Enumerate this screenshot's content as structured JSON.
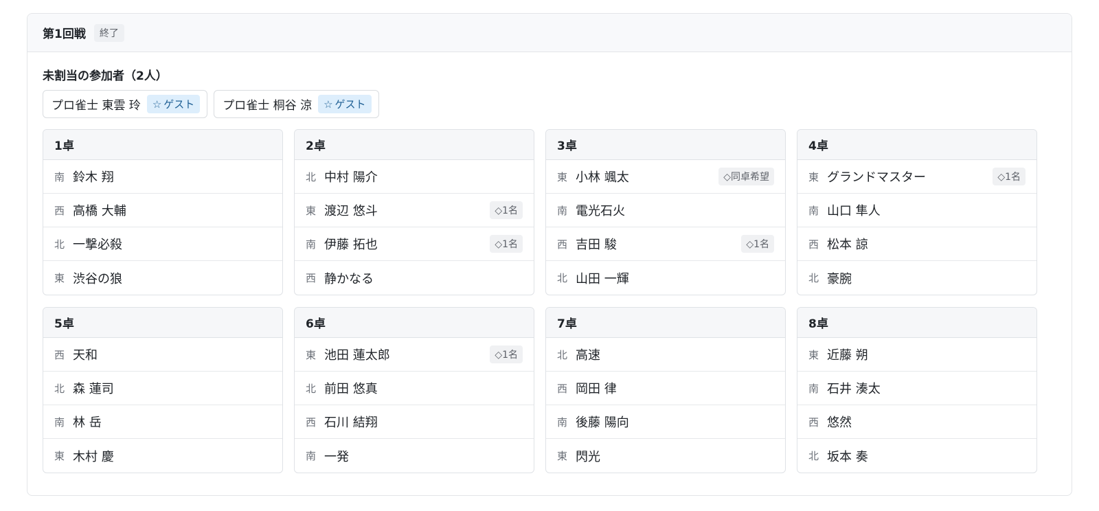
{
  "round": {
    "title": "第1回戦",
    "status": "終了"
  },
  "unassigned": {
    "title": "未割当の参加者（2人）",
    "participants": [
      {
        "name": "プロ雀士 東雲 玲",
        "badge_icon": "star-icon",
        "badge": "ゲスト"
      },
      {
        "name": "プロ雀士 桐谷 涼",
        "badge_icon": "star-icon",
        "badge": "ゲスト"
      }
    ]
  },
  "tables": [
    {
      "label": "1卓",
      "seats": [
        {
          "wind": "南",
          "name": "鈴木 翔",
          "tag": ""
        },
        {
          "wind": "西",
          "name": "高橋 大輔",
          "tag": ""
        },
        {
          "wind": "北",
          "name": "一撃必殺",
          "tag": ""
        },
        {
          "wind": "東",
          "name": "渋谷の狼",
          "tag": ""
        }
      ]
    },
    {
      "label": "2卓",
      "seats": [
        {
          "wind": "北",
          "name": "中村 陽介",
          "tag": ""
        },
        {
          "wind": "東",
          "name": "渡辺 悠斗",
          "tag": "◇1名"
        },
        {
          "wind": "南",
          "name": "伊藤 拓也",
          "tag": "◇1名"
        },
        {
          "wind": "西",
          "name": "静かなる",
          "tag": ""
        }
      ]
    },
    {
      "label": "3卓",
      "seats": [
        {
          "wind": "東",
          "name": "小林 颯太",
          "tag": "◇同卓希望"
        },
        {
          "wind": "南",
          "name": "電光石火",
          "tag": ""
        },
        {
          "wind": "西",
          "name": "吉田 駿",
          "tag": "◇1名"
        },
        {
          "wind": "北",
          "name": "山田 一輝",
          "tag": ""
        }
      ]
    },
    {
      "label": "4卓",
      "seats": [
        {
          "wind": "東",
          "name": "グランドマスター",
          "tag": "◇1名"
        },
        {
          "wind": "南",
          "name": "山口 隼人",
          "tag": ""
        },
        {
          "wind": "西",
          "name": "松本 諒",
          "tag": ""
        },
        {
          "wind": "北",
          "name": "豪腕",
          "tag": ""
        }
      ]
    },
    {
      "label": "5卓",
      "seats": [
        {
          "wind": "西",
          "name": "天和",
          "tag": ""
        },
        {
          "wind": "北",
          "name": "森 蓮司",
          "tag": ""
        },
        {
          "wind": "南",
          "name": "林 岳",
          "tag": ""
        },
        {
          "wind": "東",
          "name": "木村 慶",
          "tag": ""
        }
      ]
    },
    {
      "label": "6卓",
      "seats": [
        {
          "wind": "東",
          "name": "池田 蓮太郎",
          "tag": "◇1名"
        },
        {
          "wind": "北",
          "name": "前田 悠真",
          "tag": ""
        },
        {
          "wind": "西",
          "name": "石川 結翔",
          "tag": ""
        },
        {
          "wind": "南",
          "name": "一発",
          "tag": ""
        }
      ]
    },
    {
      "label": "7卓",
      "seats": [
        {
          "wind": "北",
          "name": "高速",
          "tag": ""
        },
        {
          "wind": "西",
          "name": "岡田 律",
          "tag": ""
        },
        {
          "wind": "南",
          "name": "後藤 陽向",
          "tag": ""
        },
        {
          "wind": "東",
          "name": "閃光",
          "tag": ""
        }
      ]
    },
    {
      "label": "8卓",
      "seats": [
        {
          "wind": "東",
          "name": "近藤 朔",
          "tag": ""
        },
        {
          "wind": "南",
          "name": "石井 湊太",
          "tag": ""
        },
        {
          "wind": "西",
          "name": "悠然",
          "tag": ""
        },
        {
          "wind": "北",
          "name": "坂本 奏",
          "tag": ""
        }
      ]
    }
  ]
}
